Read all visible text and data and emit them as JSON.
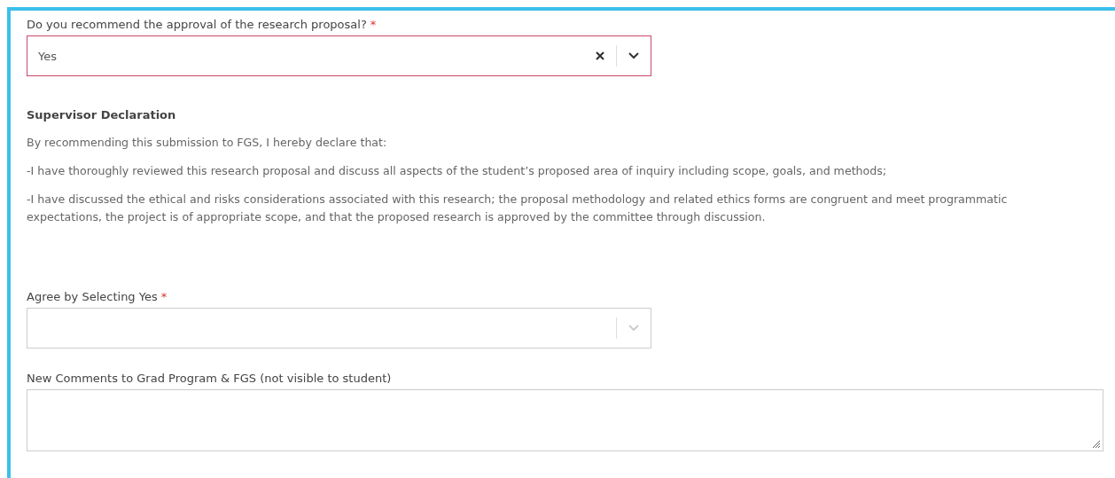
{
  "fields_top": [
    {
      "kind": "select",
      "label": "Do you recommend the approval of the research proposal?",
      "required_mark": "*",
      "value": "Yes",
      "invalid": true
    }
  ],
  "declaration": {
    "heading": "Supervisor Declaration",
    "paragraphs": [
      "By recommending this submission to FGS, I hereby declare that:",
      "-I have thoroughly reviewed this research proposal and discuss all aspects of the student’s proposed area of inquiry including scope, goals, and methods;",
      "-I have discussed the ethical and risks considerations associated with this research; the proposal methodology and related ethics forms are congruent and meet programmatic expectations, the project is of appropriate scope, and that the proposed research is approved by the committee through discussion."
    ]
  },
  "fields_bottom": [
    {
      "kind": "select",
      "label": "Agree by Selecting Yes",
      "required_mark": "*",
      "invalid": false
    },
    {
      "kind": "textarea",
      "label": "New Comments to Grad Program & FGS (not visible to student)"
    }
  ]
}
